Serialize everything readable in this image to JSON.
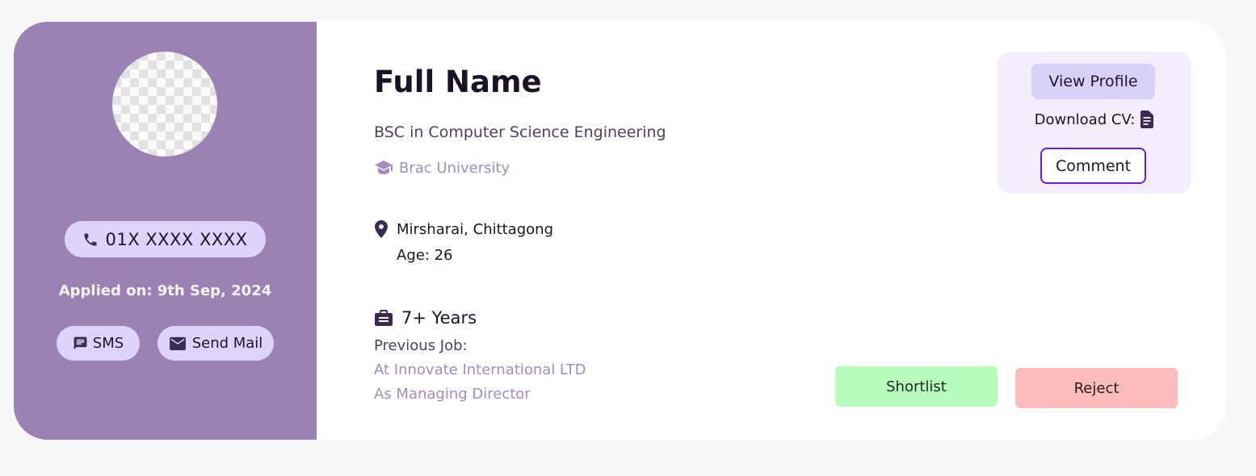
{
  "candidate": {
    "full_name": "Full Name",
    "degree": "BSC in Computer Science Engineering",
    "university": "Brac University",
    "location": "Mirsharai, Chittagong",
    "age": "Age: 26",
    "experience": "7+ Years",
    "previous_job_label": "Previous Job:",
    "previous_company": "At Innovate International LTD",
    "previous_role": "As Managing Director"
  },
  "sidebar": {
    "phone": "01X XXXX XXXX",
    "applied_label": "Applied on: ",
    "applied_date": "9th Sep, 2024",
    "sms_label": "SMS",
    "mail_label": "Send Mail"
  },
  "actions": {
    "view_profile": "View Profile",
    "download_cv": "Download CV:",
    "comment": "Comment",
    "shortlist": "Shortlist",
    "reject": "Reject"
  },
  "icons": {
    "phone": "phone-icon",
    "sms": "message-icon",
    "mail": "mail-icon",
    "university": "graduation-cap-icon",
    "location": "map-pin-icon",
    "experience": "briefcase-icon",
    "download": "document-icon"
  },
  "colors": {
    "sidebar": "#9a82b4",
    "pill": "#ddd3fb",
    "accent_purple": "#6a1ddb",
    "shortlist": "#b7fbbd",
    "reject": "#fbbcbc",
    "muted_text": "#a28cbc"
  }
}
